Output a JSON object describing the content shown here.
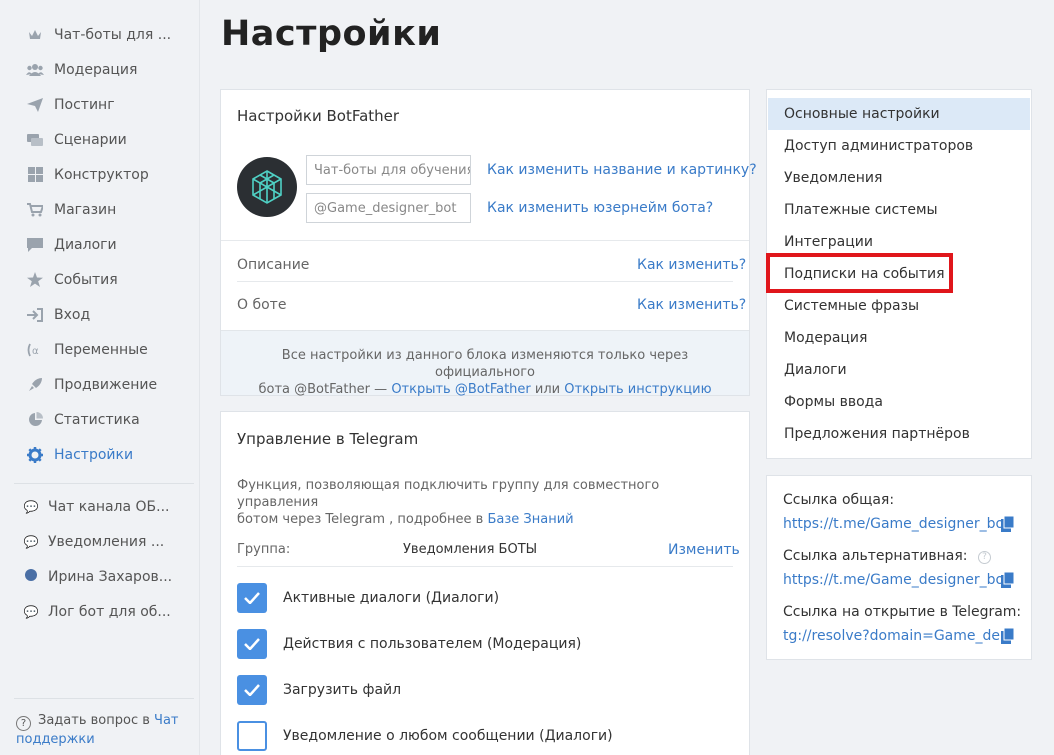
{
  "sidebar": {
    "items": [
      {
        "label": "Чат-боты для ...",
        "icon": "crown-icon"
      },
      {
        "label": "Модерация",
        "icon": "users-icon"
      },
      {
        "label": "Постинг",
        "icon": "paper-plane-icon"
      },
      {
        "label": "Сценарии",
        "icon": "scenario-icon"
      },
      {
        "label": "Конструктор",
        "icon": "grid-icon"
      },
      {
        "label": "Магазин",
        "icon": "cart-icon"
      },
      {
        "label": "Диалоги",
        "icon": "chat-bubble-icon"
      },
      {
        "label": "События",
        "icon": "star-icon"
      },
      {
        "label": "Вход",
        "icon": "sign-in-icon"
      },
      {
        "label": "Переменные",
        "icon": "variable-icon"
      },
      {
        "label": "Продвижение",
        "icon": "rocket-icon"
      },
      {
        "label": "Статистика",
        "icon": "pie-chart-icon"
      },
      {
        "label": "Настройки",
        "icon": "gear-icon"
      }
    ],
    "chats": [
      {
        "label": "Чат канала ОБ..."
      },
      {
        "label": "Уведомления ..."
      },
      {
        "label": "Ирина Захаров..."
      },
      {
        "label": "Лог бот для об..."
      }
    ],
    "help_text": "Задать вопрос в",
    "help_link": "Чат поддержки"
  },
  "page": {
    "title": "Настройки"
  },
  "botfather": {
    "title": "Настройки BotFather",
    "name_placeholder": "Чат-боты для обучения",
    "username_placeholder": "@Game_designer_bot",
    "change_name_link": "Как изменить название и картинку?",
    "change_username_link": "Как изменить юзернейм бота?",
    "description_label": "Описание",
    "description_link": "Как изменить?",
    "about_label": "О боте",
    "about_link": "Как изменить?",
    "note_text_1": "Все настройки из данного блока изменяются только через официального",
    "note_text_2": "бота @BotFather —",
    "note_link_1": "Открыть @BotFather",
    "note_or": "или",
    "note_link_2": "Открыть инструкцию"
  },
  "telegram": {
    "title": "Управление в Telegram",
    "desc_1": "Функция, позволяющая подключить группу для совместного управления",
    "desc_2": "ботом через Telegram , подробнее в",
    "desc_link": "Базе Знаний",
    "group_label": "Группа:",
    "group_value": "Уведомления БОТЫ",
    "change_link": "Изменить",
    "checkboxes": [
      {
        "label": "Активные диалоги (Диалоги)",
        "checked": true
      },
      {
        "label": "Действия с пользователем (Модерация)",
        "checked": true
      },
      {
        "label": "Загрузить файл",
        "checked": true
      },
      {
        "label": "Уведомление о любом сообщении (Диалоги)",
        "checked": false
      }
    ]
  },
  "settings_menu": {
    "items": [
      {
        "label": "Основные настройки",
        "active": true
      },
      {
        "label": "Доступ администраторов",
        "active": false
      },
      {
        "label": "Уведомления",
        "active": false
      },
      {
        "label": "Платежные системы",
        "active": false
      },
      {
        "label": "Интеграции",
        "active": false
      },
      {
        "label": "Подписки на события",
        "active": false
      },
      {
        "label": "Системные фразы",
        "active": false
      },
      {
        "label": "Модерация",
        "active": false
      },
      {
        "label": "Диалоги",
        "active": false
      },
      {
        "label": "Формы ввода",
        "active": false
      },
      {
        "label": "Предложения партнёров",
        "active": false
      }
    ]
  },
  "links": {
    "general_label": "Ссылка общая:",
    "general_url": "https://t.me/Game_designer_bot",
    "alt_label": "Ссылка альтернативная:",
    "alt_url": "https://t.me/Game_designer_bot",
    "tg_label": "Ссылка на открытие в Telegram:",
    "tg_url": "tg://resolve?domain=Game_de..."
  },
  "colors": {
    "accent": "#3a7bc8",
    "checkbox": "#4a90e2",
    "highlight": "#e0161b",
    "active_menu": "#dce9f7"
  }
}
